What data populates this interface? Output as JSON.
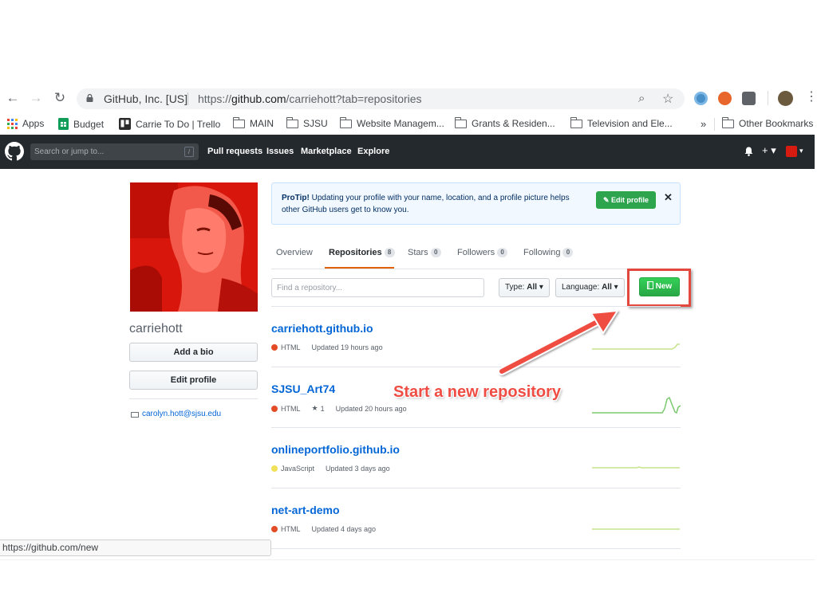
{
  "browser": {
    "site_identity": "GitHub, Inc. [US]",
    "url_prefix": "https://",
    "url_host": "github.com",
    "url_path": "/carriehott?tab=repositories",
    "bookmarks": [
      {
        "label": "Apps",
        "icon": "apps-grid-icon"
      },
      {
        "label": "Budget",
        "icon": "sheets-icon"
      },
      {
        "label": "Carrie To Do | Trello",
        "icon": "trello-icon"
      },
      {
        "label": "MAIN",
        "icon": "folder-icon"
      },
      {
        "label": "SJSU",
        "icon": "folder-icon"
      },
      {
        "label": "Website Managem...",
        "icon": "folder-icon"
      },
      {
        "label": "Grants & Residen...",
        "icon": "folder-icon"
      },
      {
        "label": "Television and Ele...",
        "icon": "folder-icon"
      }
    ],
    "overflow_label": "»",
    "other_bookmarks": "Other Bookmarks",
    "status_url": "https://github.com/new"
  },
  "github_header": {
    "search_placeholder": "Search or jump to...",
    "search_shortcut": "/",
    "nav": [
      "Pull requests",
      "Issues",
      "Marketplace",
      "Explore"
    ],
    "plus_label": "+ ▾",
    "avatar_caret": "▾"
  },
  "profile": {
    "username": "carriehott",
    "add_bio_label": "Add a bio",
    "edit_profile_label": "Edit profile",
    "email": "carolyn.hott@sjsu.edu"
  },
  "protip": {
    "title": "ProTip!",
    "message": "Updating your profile with your name, location, and a profile picture helps other GitHub users get to know you.",
    "button_label": "Edit profile",
    "close_label": "✕"
  },
  "tabs": [
    {
      "label": "Overview",
      "count": ""
    },
    {
      "label": "Repositories",
      "count": "8"
    },
    {
      "label": "Stars",
      "count": "0"
    },
    {
      "label": "Followers",
      "count": "0"
    },
    {
      "label": "Following",
      "count": "0"
    }
  ],
  "filters": {
    "find_placeholder": "Find a repository...",
    "type_label": "Type:",
    "type_value": "All",
    "language_label": "Language:",
    "language_value": "All",
    "new_label": "New"
  },
  "repos": [
    {
      "name": "carriehott.github.io",
      "language": "HTML",
      "lang_color": "#e34c26",
      "stars": "",
      "updated": "Updated 19 hours ago"
    },
    {
      "name": "SJSU_Art74",
      "language": "HTML",
      "lang_color": "#e34c26",
      "stars": "1",
      "updated": "Updated 20 hours ago"
    },
    {
      "name": "onlineportfolio.github.io",
      "language": "JavaScript",
      "lang_color": "#f1e05a",
      "stars": "",
      "updated": "Updated 3 days ago"
    },
    {
      "name": "net-art-demo",
      "language": "HTML",
      "lang_color": "#e34c26",
      "stars": "",
      "updated": "Updated 4 days ago"
    }
  ],
  "annotation": {
    "callout_text": "Start a new repository",
    "color": "#ef4d43"
  },
  "colors": {
    "header_bg": "#24292e",
    "link_blue": "#0366d6",
    "new_green": "#2ea44f",
    "active_tab_accent": "#e36209"
  }
}
